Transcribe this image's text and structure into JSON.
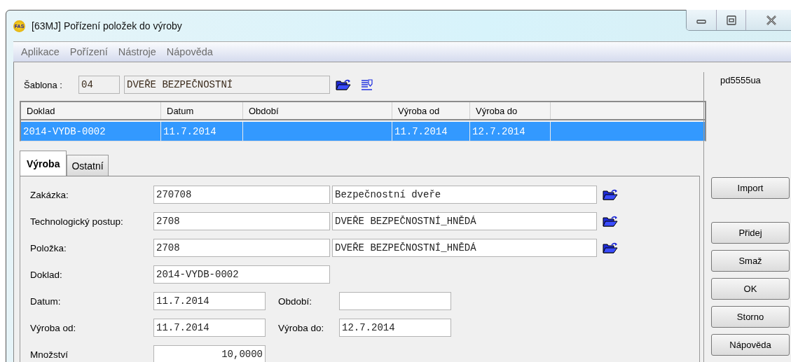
{
  "window": {
    "title": "[63MJ] Pořízení položek do výroby",
    "badge": "FAS"
  },
  "menu": [
    "Aplikace",
    "Pořízení",
    "Nástroje",
    "Nápověda"
  ],
  "template": {
    "label": "Šablona :",
    "code": "04",
    "name": "DVEŘE BEZPEČNOSTNÍ"
  },
  "user": "pd5555ua",
  "table": {
    "columns": [
      "Doklad",
      "Datum",
      "Období",
      "Výroba od",
      "Výroba do"
    ],
    "rows": [
      {
        "cells": [
          "2014-VYDB-0002",
          "11.7.2014",
          null,
          "11.7.2014",
          "12.7.2014"
        ],
        "selected": true
      }
    ]
  },
  "tabs": [
    {
      "label": "Výroba",
      "selected": true
    },
    {
      "label": "Ostatní",
      "selected": false
    }
  ],
  "form": [
    {
      "kind": "lookup",
      "label": "Zakázka:",
      "value": "270708",
      "description": "Bezpečnostní dveře"
    },
    {
      "kind": "lookup",
      "label": "Technologický postup:",
      "value": "2708",
      "description": "DVEŘE BEZPEČNOSTNÍ_HNĚDÁ"
    },
    {
      "kind": "lookup",
      "label": "Položka:",
      "value": "2708",
      "description": "DVEŘE BEZPEČNOSTNÍ_HNĚDÁ"
    },
    {
      "kind": "wide",
      "label": "Doklad:",
      "value": "2014-VYDB-0002"
    },
    {
      "kind": "pair",
      "label": "Datum:",
      "value": "11.7.2014",
      "side_label": "Období:"
    },
    {
      "kind": "pair",
      "label": "Výroba od:",
      "value": "11.7.2014",
      "side_label": "Výroba do:",
      "side_value": "12.7.2014"
    },
    {
      "kind": "number",
      "label": "Množství",
      "value": "10,0000"
    }
  ],
  "button_groups": [
    [
      "Import"
    ],
    [
      "Přidej",
      "Smaž",
      "OK",
      "Storno",
      "Nápověda"
    ]
  ]
}
